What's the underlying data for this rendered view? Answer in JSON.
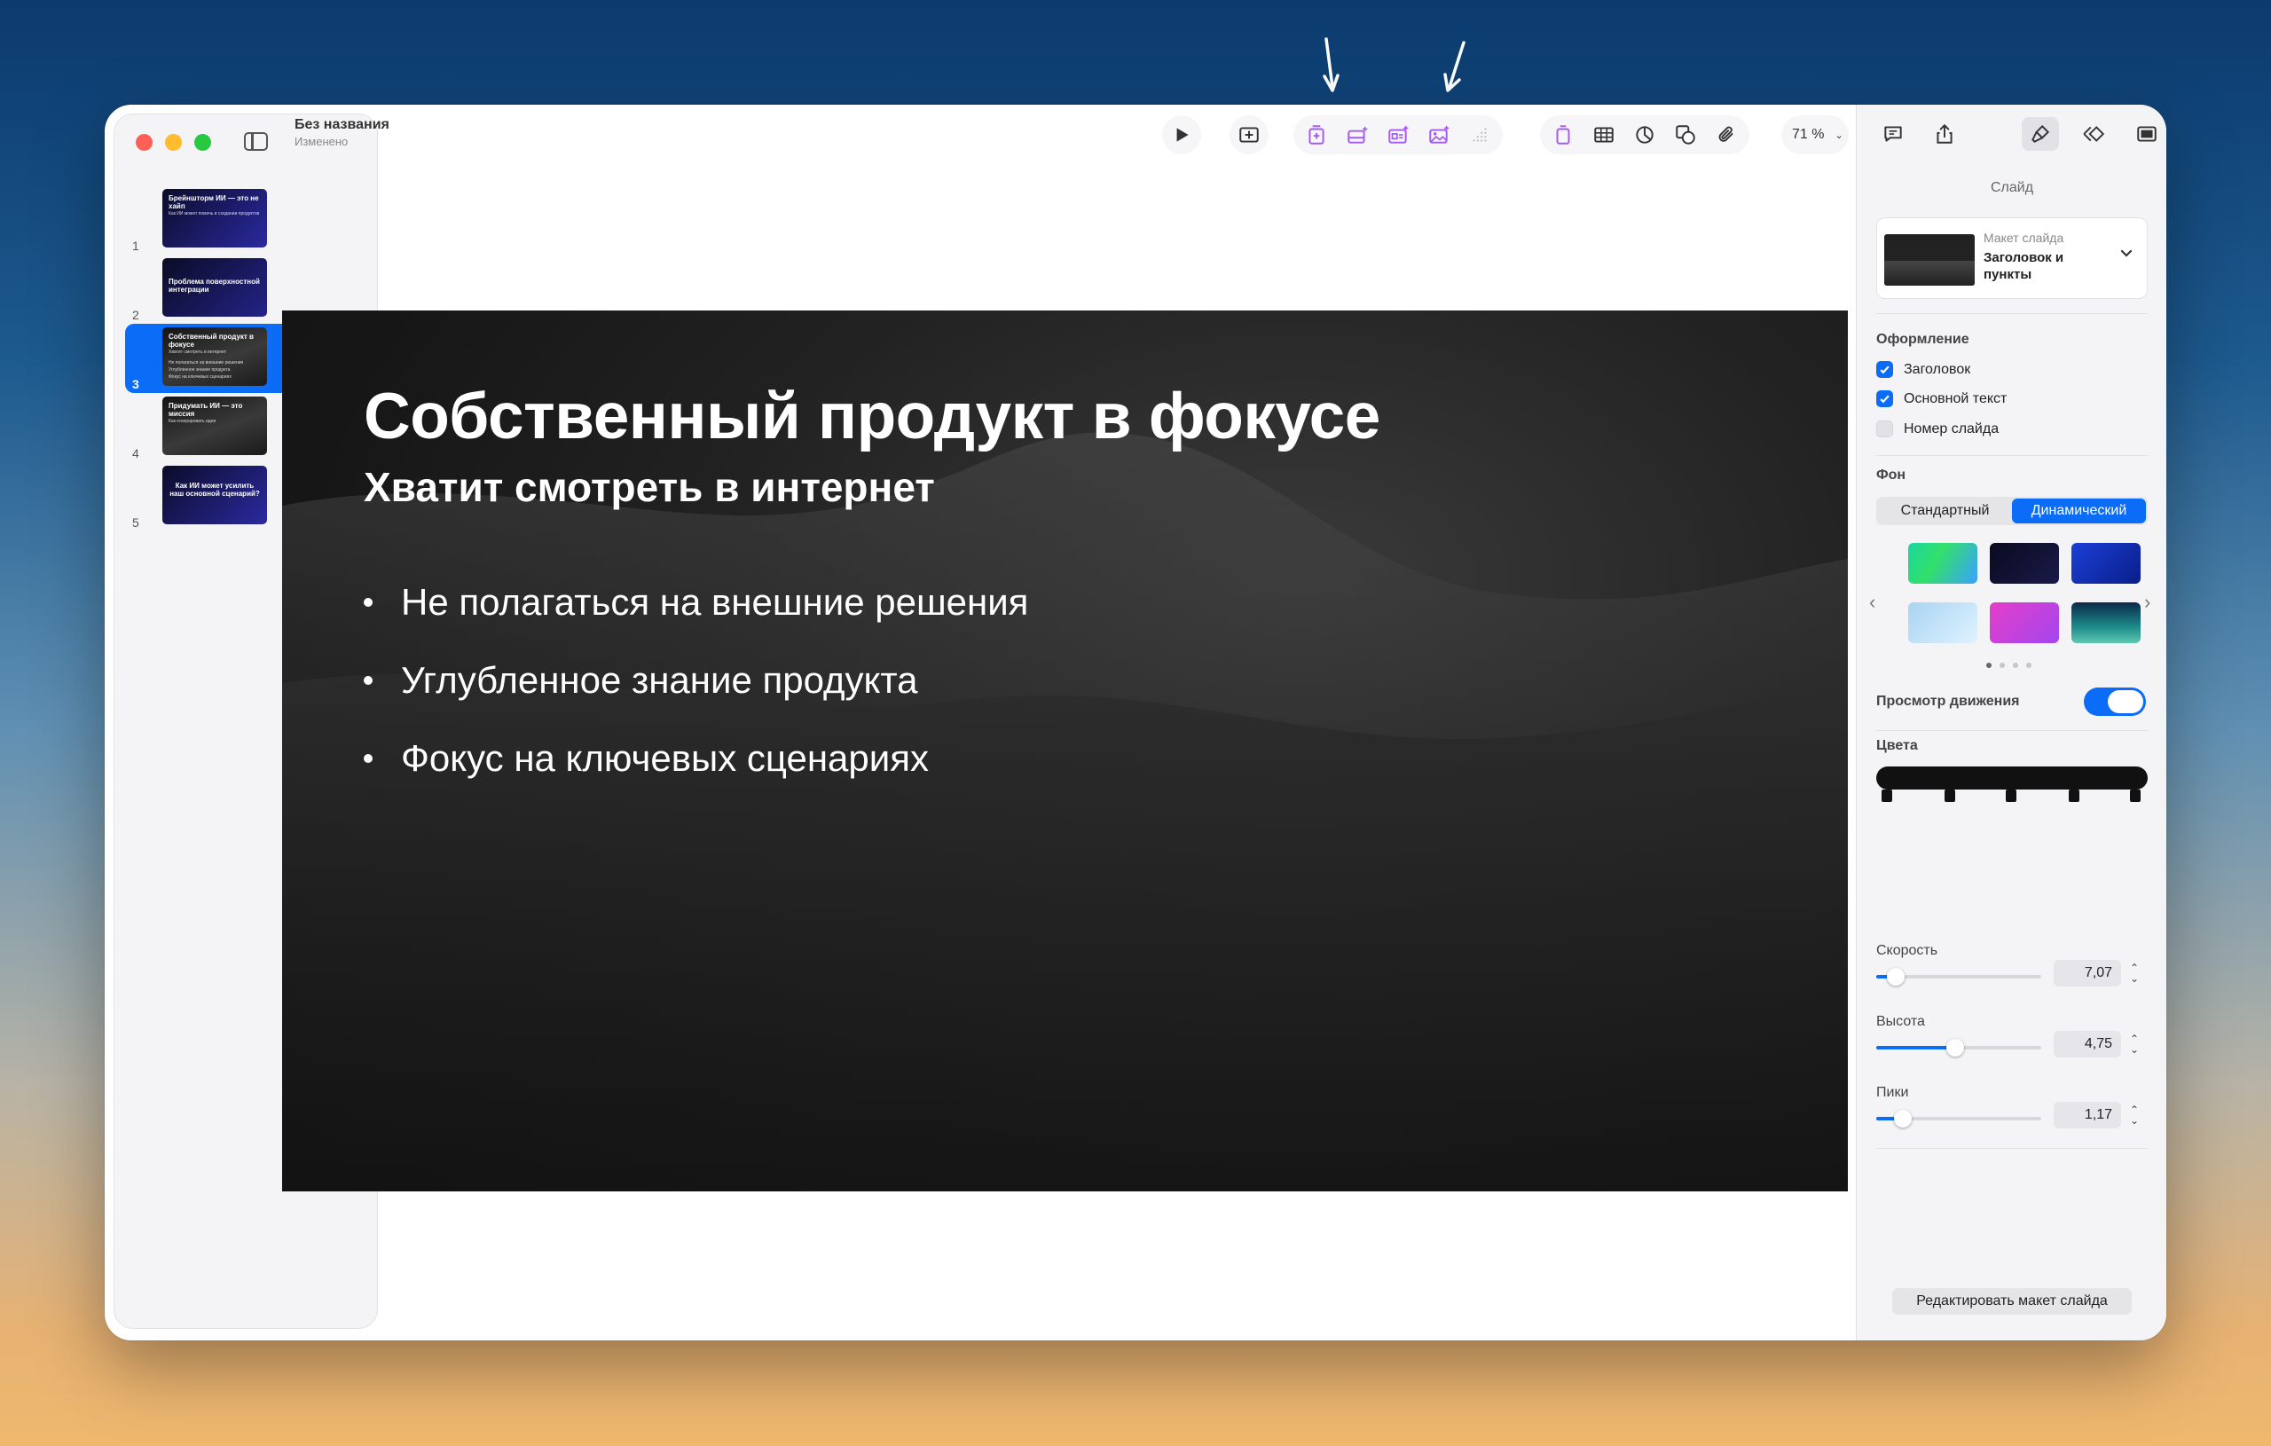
{
  "document": {
    "title": "Без названия",
    "status": "Изменено"
  },
  "toolbar": {
    "zoom": "71 %"
  },
  "slides": [
    {
      "num": "1",
      "title": "Брейншторм ИИ — это не хайп",
      "sub": "Как ИИ может помочь в создании продуктов",
      "bg": "#1a1a6e"
    },
    {
      "num": "2",
      "title": "Проблема поверхностной интеграции",
      "sub": "",
      "bg": "#141a5a"
    },
    {
      "num": "3",
      "title": "Собственный продукт в фокусе",
      "sub": "Хватит смотреть в интернет",
      "bg": "#1c1c1c"
    },
    {
      "num": "4",
      "title": "Придумать ИИ — это миссия",
      "sub": "Как генерировать идеи",
      "bg": "#202020"
    },
    {
      "num": "5",
      "title": "Как ИИ может усилить наш основной сценарий?",
      "sub": "",
      "bg": "#15155e"
    }
  ],
  "slide": {
    "title": "Собственный продукт в фокусе",
    "subtitle": "Хватит смотреть в интернет",
    "bullets": [
      "Не полагаться на внешние решения",
      "Углубленное знание продукта",
      "Фокус на ключевых сценариях"
    ]
  },
  "inspector": {
    "header": "Слайд",
    "layout_caption": "Макет слайда",
    "layout_name_1": "Заголовок и",
    "layout_name_2": "пункты",
    "appearance_title": "Оформление",
    "cb_title": "Заголовок",
    "cb_body": "Основной текст",
    "cb_number": "Номер слайда",
    "bg_title": "Фон",
    "bg_standard": "Стандартный",
    "bg_dynamic": "Динамический",
    "motion_preview": "Просмотр движения",
    "colors": "Цвета",
    "speed_label": "Скорость",
    "speed_value": "7,07",
    "speed_level": 0.12,
    "height_label": "Высота",
    "height_value": "4,75",
    "height_level": 0.48,
    "peaks_label": "Пики",
    "peaks_value": "1,17",
    "peaks_level": 0.16,
    "edit_layout": "Редактировать макет слайда"
  },
  "colors": {
    "accent": "#0a6cf7",
    "ai_purple": "#a35bf0"
  }
}
